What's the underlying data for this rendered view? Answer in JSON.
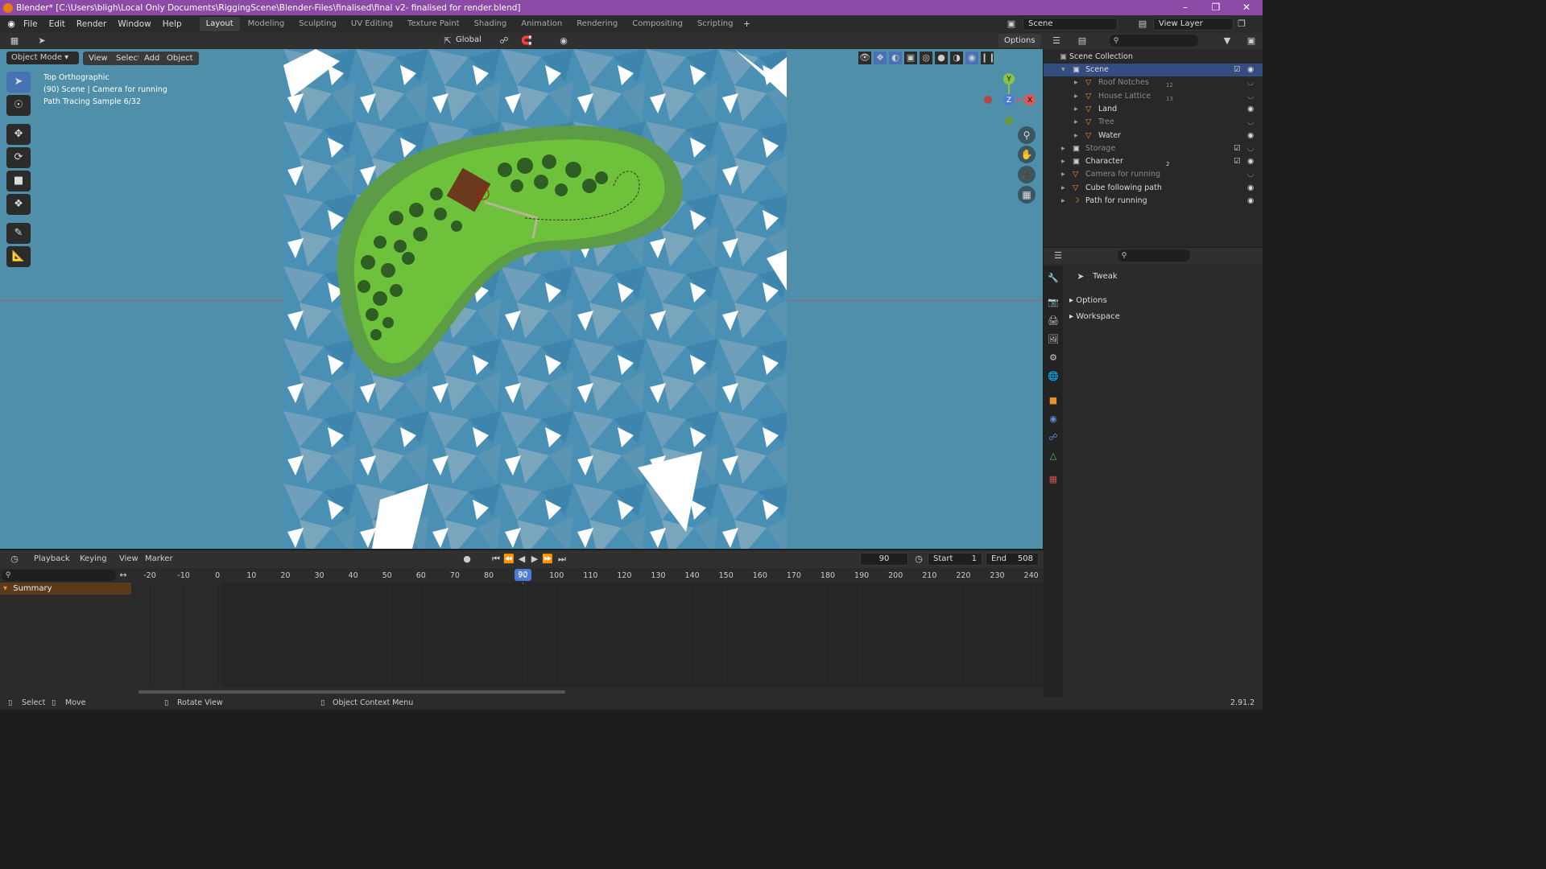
{
  "title_bar": {
    "text": "Blender* [C:\\Users\\bligh\\Local Only Documents\\RiggingScene\\Blender-Files\\finalised\\final v2-  finalised for render.blend]"
  },
  "menu": [
    "File",
    "Edit",
    "Render",
    "Window",
    "Help"
  ],
  "workspaces": [
    "Layout",
    "Modeling",
    "Sculpting",
    "UV Editing",
    "Texture Paint",
    "Shading",
    "Animation",
    "Rendering",
    "Compositing",
    "Scripting"
  ],
  "active_workspace": "Layout",
  "scene_field": "Scene",
  "view_layer_field": "View Layer",
  "viewport": {
    "mode": "Object Mode",
    "menus": [
      "View",
      "Select",
      "Add",
      "Object"
    ],
    "orientation": "Global",
    "options_label": "Options",
    "overlay_text": [
      "Top Orthographic",
      "(90) Scene | Camera for running",
      "Path Tracing Sample 6/32"
    ],
    "gizmo": {
      "y": "Y",
      "z": "Z",
      "x": "X"
    }
  },
  "outliner": {
    "root": "Scene Collection",
    "rows": [
      {
        "label": "Scene",
        "level": 1,
        "dim": false
      },
      {
        "label": "Roof Notches",
        "level": 2,
        "dim": true,
        "badge": "12"
      },
      {
        "label": "House Lattice",
        "level": 2,
        "dim": true,
        "badge": "13"
      },
      {
        "label": "Land",
        "level": 2,
        "dim": false
      },
      {
        "label": "Tree",
        "level": 2,
        "dim": true
      },
      {
        "label": "Water",
        "level": 2,
        "dim": false
      },
      {
        "label": "Storage",
        "level": 1,
        "dim": true
      },
      {
        "label": "Character",
        "level": 1,
        "dim": false,
        "badge": "2"
      },
      {
        "label": "Camera for running",
        "level": 1,
        "dim": true
      },
      {
        "label": "Cube following path",
        "level": 1,
        "dim": false
      },
      {
        "label": "Path for running",
        "level": 1,
        "dim": false
      }
    ]
  },
  "properties": {
    "tool_name": "Tweak",
    "panels": [
      "Options",
      "Workspace"
    ]
  },
  "timeline": {
    "menus": [
      "Playback",
      "Keying",
      "View",
      "Marker"
    ],
    "current_frame": "90",
    "start_label": "Start",
    "start": "1",
    "end_label": "End",
    "end": "508",
    "summary_label": "Summary",
    "ticks": [
      "-20",
      "-10",
      "0",
      "10",
      "20",
      "30",
      "40",
      "50",
      "60",
      "70",
      "80",
      "90",
      "100",
      "110",
      "120",
      "130",
      "140",
      "150",
      "160",
      "170",
      "180",
      "190",
      "200",
      "210",
      "220",
      "230",
      "240"
    ]
  },
  "status": {
    "select": "Select",
    "move": "Move",
    "rotate": "Rotate View",
    "context": "Object Context Menu",
    "version": "2.91.2"
  }
}
